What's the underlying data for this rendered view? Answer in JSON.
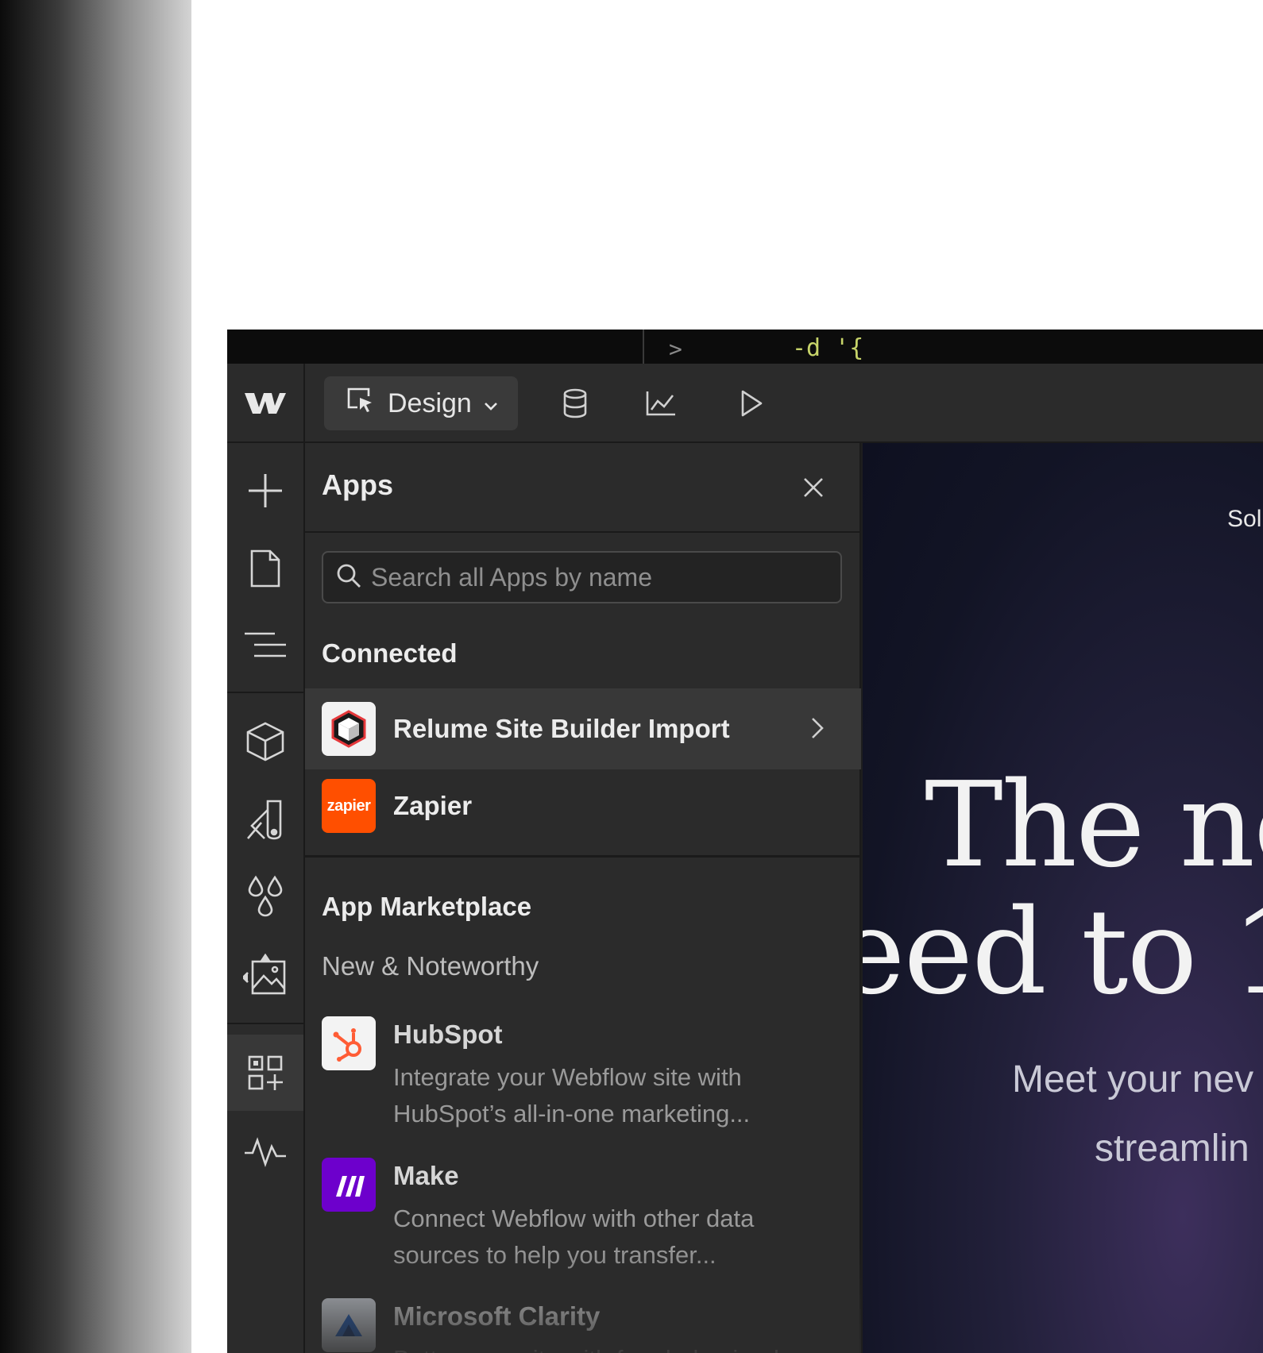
{
  "terminal": {
    "prompt": ">",
    "command": "-d '{"
  },
  "topbar": {
    "mode_label": "Design",
    "icons": [
      "design-cursor-icon",
      "database-icon",
      "analytics-icon",
      "play-icon"
    ]
  },
  "sidebar": {
    "items": [
      "add-icon",
      "page-icon",
      "navigator-icon",
      "components-icon",
      "style-manager-icon",
      "variables-icon",
      "assets-icon",
      "apps-icon",
      "audit-icon"
    ],
    "active": "apps-icon"
  },
  "panel": {
    "title": "Apps",
    "search_placeholder": "Search all Apps by name",
    "connected_title": "Connected",
    "connected": [
      {
        "name": "Relume Site Builder Import",
        "icon": "relume-icon"
      },
      {
        "name": "Zapier",
        "icon": "zapier-icon",
        "icon_text": "zapier"
      }
    ],
    "marketplace_title": "App Marketplace",
    "marketplace_sub": "New & Noteworthy",
    "marketplace": [
      {
        "name": "HubSpot",
        "desc": "Integrate your Webflow site with HubSpot’s all-in-one marketing...",
        "icon": "hubspot-icon"
      },
      {
        "name": "Make",
        "desc": "Connect Webflow with other data sources to help you transfer...",
        "icon": "make-icon"
      },
      {
        "name": "Microsoft Clarity",
        "desc": "Better your site with free behavioral",
        "icon": "clarity-icon"
      }
    ]
  },
  "canvas": {
    "nav_text": "Sol",
    "hero_line1": "The ne",
    "hero_line2": "eed to 1",
    "sub_line1": "Meet your nev",
    "sub_line2": "streamlin"
  },
  "colors": {
    "zapier": "#ff4f00",
    "hubspot": "#ff5c35",
    "make": "#6d00cc",
    "clarity": "#1e5bb8"
  }
}
